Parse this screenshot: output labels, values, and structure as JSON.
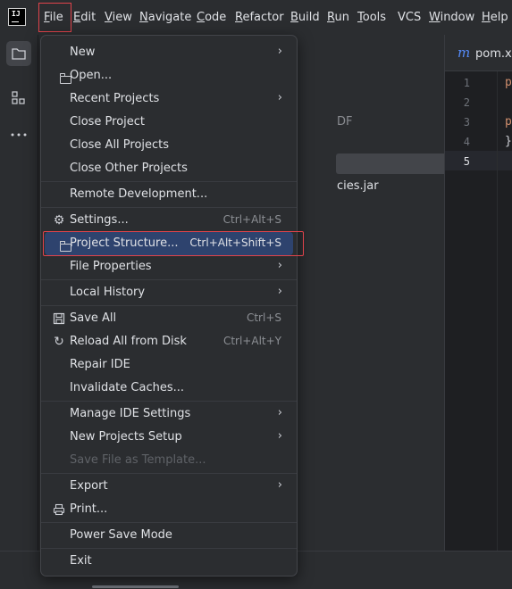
{
  "menubar": {
    "items": [
      {
        "label": "File",
        "u": "F",
        "rest": "ile"
      },
      {
        "label": "Edit",
        "u": "E",
        "rest": "dit"
      },
      {
        "label": "View",
        "u": "V",
        "rest": "iew"
      },
      {
        "label": "Navigate",
        "u": "N",
        "rest": "avigate"
      },
      {
        "label": "Code",
        "u": "C",
        "rest": "ode"
      },
      {
        "label": "Refactor",
        "u": "R",
        "rest": "efactor"
      },
      {
        "label": "Build",
        "u": "B",
        "rest": "uild"
      },
      {
        "label": "Run",
        "u": "R",
        "rest": "un"
      },
      {
        "label": "Tools",
        "u": "T",
        "rest": "ools"
      },
      {
        "label": "VCS",
        "u": "",
        "rest": "VCS"
      },
      {
        "label": "Window",
        "u": "W",
        "rest": "indow"
      },
      {
        "label": "Help",
        "u": "H",
        "rest": "elp"
      }
    ]
  },
  "logo_text": "IJ",
  "project_panel": {
    "partial_pdf": "DF",
    "partial_jar": "cies.jar"
  },
  "editor": {
    "tab_icon": "m",
    "tab_label": "pom.xml",
    "line_numbers": [
      "1",
      "2",
      "3",
      "4",
      "5"
    ],
    "code_fragments": [
      "p",
      "p",
      "}"
    ]
  },
  "file_menu": {
    "items": [
      {
        "label": "New",
        "icon": "",
        "shortcut": "",
        "submenu": true
      },
      {
        "label": "Open...",
        "icon": "folder-icon",
        "shortcut": "",
        "submenu": false
      },
      {
        "label": "Recent Projects",
        "icon": "",
        "shortcut": "",
        "submenu": true
      },
      {
        "label": "Close Project",
        "icon": "",
        "shortcut": "",
        "submenu": false
      },
      {
        "label": "Close All Projects",
        "icon": "",
        "shortcut": "",
        "submenu": false
      },
      {
        "label": "Close Other Projects",
        "icon": "",
        "shortcut": "",
        "submenu": false
      },
      {
        "label": "Remote Development...",
        "icon": "",
        "shortcut": "",
        "submenu": false
      },
      {
        "label": "Settings...",
        "icon": "gear-icon",
        "shortcut": "Ctrl+Alt+S",
        "submenu": false
      },
      {
        "label": "Project Structure...",
        "icon": "project-structure-icon",
        "shortcut": "Ctrl+Alt+Shift+S",
        "submenu": false,
        "selected": true
      },
      {
        "label": "File Properties",
        "icon": "",
        "shortcut": "",
        "submenu": true
      },
      {
        "label": "Local History",
        "icon": "",
        "shortcut": "",
        "submenu": true
      },
      {
        "label": "Save All",
        "icon": "save-icon",
        "shortcut": "Ctrl+S",
        "submenu": false
      },
      {
        "label": "Reload All from Disk",
        "icon": "reload-icon",
        "shortcut": "Ctrl+Alt+Y",
        "submenu": false
      },
      {
        "label": "Repair IDE",
        "icon": "",
        "shortcut": "",
        "submenu": false
      },
      {
        "label": "Invalidate Caches...",
        "icon": "",
        "shortcut": "",
        "submenu": false
      },
      {
        "label": "Manage IDE Settings",
        "icon": "",
        "shortcut": "",
        "submenu": true
      },
      {
        "label": "New Projects Setup",
        "icon": "",
        "shortcut": "",
        "submenu": true
      },
      {
        "label": "Save File as Template...",
        "icon": "",
        "shortcut": "",
        "submenu": false,
        "disabled": true
      },
      {
        "label": "Export",
        "icon": "",
        "shortcut": "",
        "submenu": true
      },
      {
        "label": "Print...",
        "icon": "print-icon",
        "shortcut": "",
        "submenu": false
      },
      {
        "label": "Power Save Mode",
        "icon": "",
        "shortcut": "",
        "submenu": false
      },
      {
        "label": "Exit",
        "icon": "",
        "shortcut": "",
        "submenu": false
      }
    ]
  },
  "colors": {
    "background": "#2b2d30",
    "editor_background": "#1e1f22",
    "selection": "#2e436e",
    "highlight_outline": "#e0434b",
    "text": "#dfe1e5",
    "shortcut_text": "#8c8f94",
    "disabled_text": "#5f6267"
  }
}
